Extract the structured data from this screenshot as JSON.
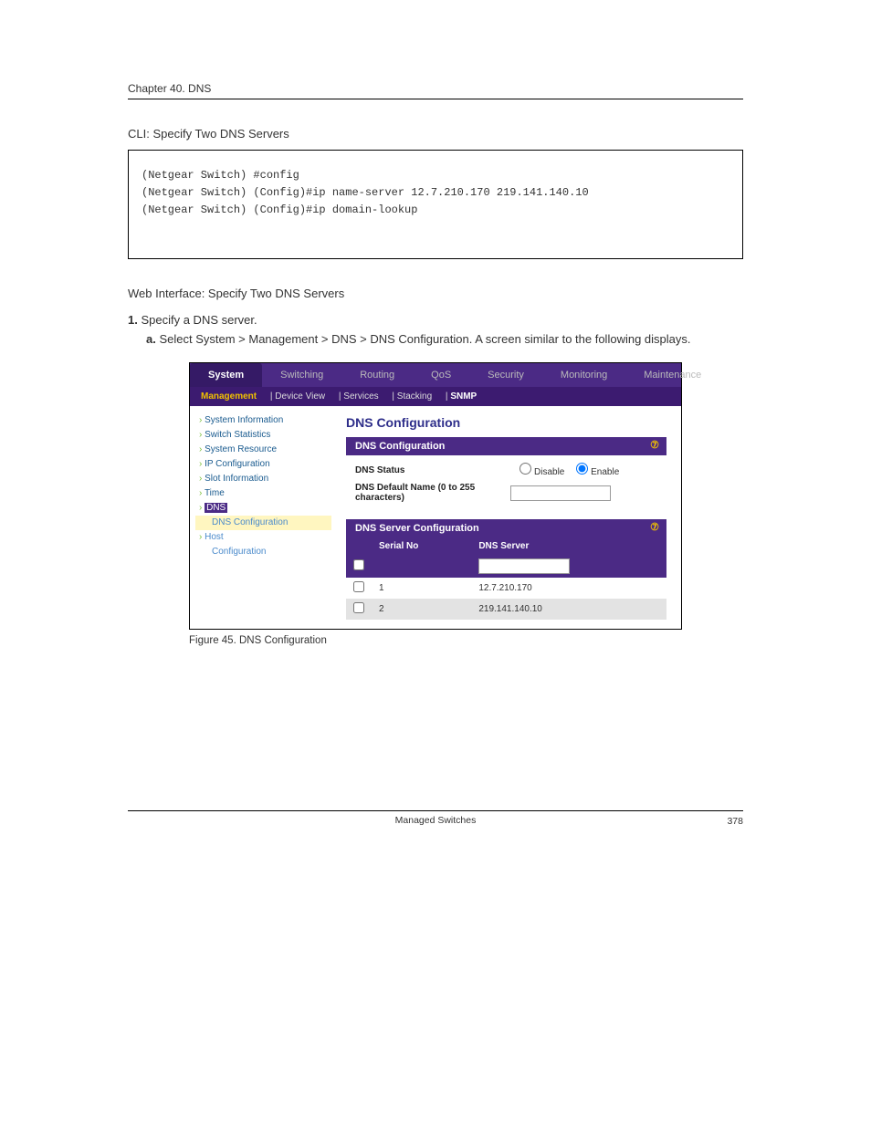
{
  "chapter": "Chapter 40.  DNS",
  "cli_section_title": "CLI: Specify Two DNS Servers",
  "cli_lines": "(Netgear Switch) #config\n(Netgear Switch) (Config)#ip name-server 12.7.210.170 219.141.140.10\n(Netgear Switch) (Config)#ip domain-lookup",
  "web_section_title": "Web Interface: Specify Two DNS Servers",
  "step1_num": "1.",
  "step1_text": "Specify a DNS server.",
  "step1a": "a.",
  "step1a_text": "Select System > Management > DNS > DNS Configuration. A screen similar to the following displays.",
  "figure_caption": "Figure 45. DNS Configuration",
  "footer_text": "Managed Switches",
  "page_number": "378",
  "ui": {
    "tabs": [
      "System",
      "Switching",
      "Routing",
      "QoS",
      "Security",
      "Monitoring",
      "Maintenance"
    ],
    "subtabs": {
      "items": [
        "Management",
        "Device View",
        "Services",
        "Stacking",
        "SNMP"
      ]
    },
    "sidebar": {
      "i1": "System Information",
      "i2": "Switch Statistics",
      "i3": "System Resource",
      "i4": "IP Configuration",
      "i5": "Slot Information",
      "i6": "Time",
      "i7": "DNS",
      "i7a": "DNS Configuration",
      "i8": "Host",
      "i8a": "Configuration"
    },
    "main": {
      "title": "DNS Configuration",
      "panel1_title": "DNS Configuration",
      "status_label": "DNS Status",
      "status_disable": "Disable",
      "status_enable": "Enable",
      "def_label": "DNS Default Name (0 to 255 characters)",
      "panel2_title": "DNS Server Configuration",
      "col_serial": "Serial No",
      "col_server": "DNS Server",
      "row1_no": "1",
      "row1_val": "12.7.210.170",
      "row2_no": "2",
      "row2_val": "219.141.140.10"
    }
  }
}
